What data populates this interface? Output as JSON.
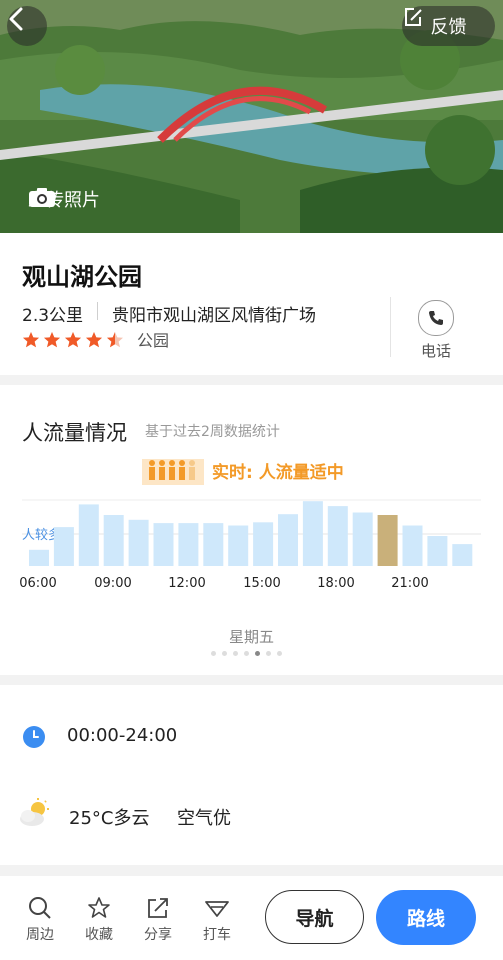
{
  "header": {
    "feedback_label": "反馈",
    "upload_label": "上传照片"
  },
  "place": {
    "name": "观山湖公园",
    "distance": "2.3公里",
    "address": "贵阳市观山湖区风情街广场",
    "category": "公园",
    "rating": 4.5,
    "phone_label": "电话"
  },
  "crowd": {
    "title": "人流量情况",
    "subtitle": "基于过去2周数据统计",
    "realtime": "实时: 人流量适中",
    "busy_label": "人较多",
    "day": "星期五",
    "page_count": 7,
    "active_page": 4
  },
  "chart_data": {
    "type": "bar",
    "x_tick_labels": [
      "06:00",
      "09:00",
      "12:00",
      "15:00",
      "18:00",
      "21:00"
    ],
    "values": [
      20,
      48,
      76,
      63,
      57,
      53,
      53,
      53,
      50,
      54,
      64,
      80,
      74,
      66,
      63,
      50,
      37,
      27
    ],
    "current_index": 14,
    "ylim": [
      0,
      100
    ],
    "colors": {
      "bar": "#cfe8fb",
      "current": "#c9b07a"
    }
  },
  "hours": {
    "text": "00:00-24:00"
  },
  "weather": {
    "temp": "25°C多云",
    "air": "空气优"
  },
  "bottom_nav": {
    "items": [
      {
        "label": "周边",
        "icon": "search-icon"
      },
      {
        "label": "收藏",
        "icon": "star-icon"
      },
      {
        "label": "分享",
        "icon": "share-icon"
      },
      {
        "label": "打车",
        "icon": "taxi-icon"
      }
    ],
    "navigate_label": "导航",
    "route_label": "路线"
  },
  "colors": {
    "accent": "#3385ff",
    "star": "#f05a28",
    "realtime": "#f39a28"
  }
}
